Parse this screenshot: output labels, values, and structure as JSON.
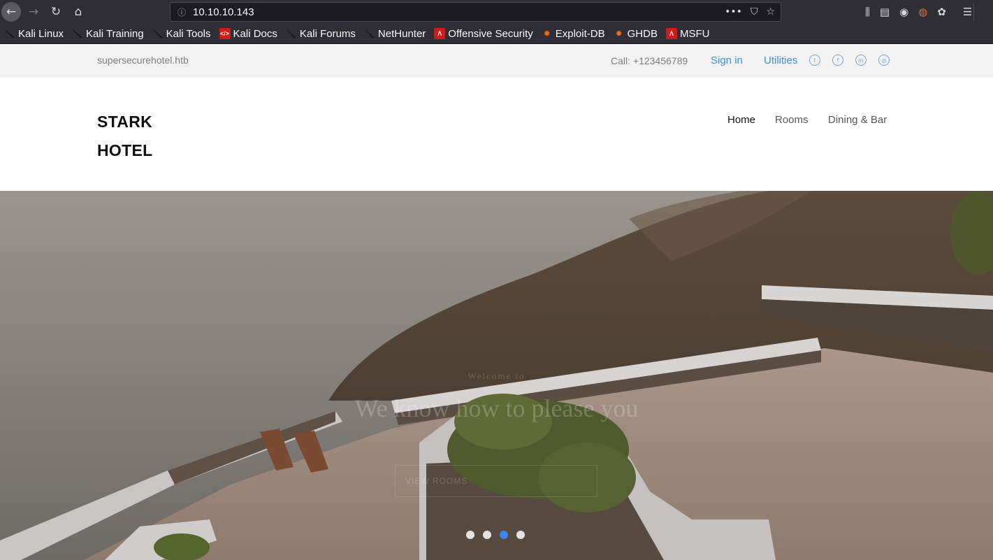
{
  "browser": {
    "url": "10.10.10.143",
    "nav": {
      "back_icon": "←",
      "forward_icon": "→",
      "reload_icon": "↻",
      "home_icon": "⌂"
    },
    "url_actions": [
      "•••",
      "⛉",
      "☆"
    ],
    "toolbar_icons": [
      "⫼",
      "▤",
      "◉",
      "◍",
      "✿",
      "☰"
    ],
    "bookmarks": [
      {
        "label": "Kali Linux",
        "icon": "kali-dragon"
      },
      {
        "label": "Kali Training",
        "icon": "kali-dragon"
      },
      {
        "label": "Kali Tools",
        "icon": "kali-dragon"
      },
      {
        "label": "Kali Docs",
        "icon": "red-book"
      },
      {
        "label": "Kali Forums",
        "icon": "kali-dragon"
      },
      {
        "label": "NetHunter",
        "icon": "kali-dragon"
      },
      {
        "label": "Offensive Security",
        "icon": "offsec-red"
      },
      {
        "label": "Exploit-DB",
        "icon": "exploitdb-orange"
      },
      {
        "label": "GHDB",
        "icon": "exploitdb-orange"
      },
      {
        "label": "MSFU",
        "icon": "offsec-red"
      }
    ]
  },
  "topbar": {
    "domain": "supersecurehotel.htb",
    "call": "Call: +123456789",
    "signin": "Sign in",
    "utilities": "Utilities",
    "social": [
      "twitter-icon",
      "facebook-icon",
      "linkedin-icon",
      "dribbble-icon"
    ]
  },
  "header": {
    "logo_line1": "STARK",
    "logo_line2": "HOTEL",
    "nav": [
      "Home",
      "Rooms",
      "Dining & Bar"
    ]
  },
  "hero": {
    "subtitle": "Welcome to",
    "title": "We know how to please you",
    "button": "VIEW ROOMS",
    "slides": 4,
    "active_slide": 3
  },
  "colors": {
    "chrome": "#2f2e34",
    "link": "#3b8fe0",
    "active_dot": "#3b86e6"
  }
}
